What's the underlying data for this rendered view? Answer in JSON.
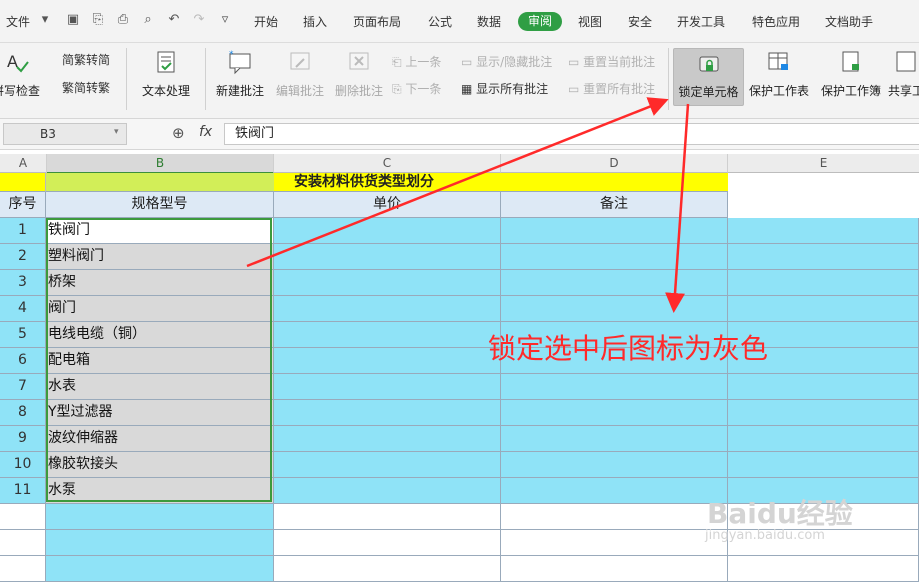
{
  "menubar": {
    "file": "文件",
    "tabs": [
      "开始",
      "插入",
      "页面布局",
      "公式",
      "数据",
      "审阅",
      "视图",
      "安全",
      "开发工具",
      "特色应用",
      "文档助手"
    ],
    "active_tab": "审阅"
  },
  "ribbon": {
    "spell_check": "拼写检查",
    "trad_to_simp": "繁转简",
    "simp_to_trad": "简转繁",
    "text_process": "文本处理",
    "new_comment": "新建批注",
    "edit_comment": "编辑批注",
    "delete_comment": "删除批注",
    "prev": "上一条",
    "next": "下一条",
    "show_hide_comment": "显示/隐藏批注",
    "show_all_comments": "显示所有批注",
    "reset_current": "重置当前批注",
    "reset_all": "重置所有批注",
    "lock_cell": "锁定单元格",
    "protect_sheet": "保护工作表",
    "protect_book": "保护工作簿",
    "share": "共享工"
  },
  "formula_bar": {
    "cell_ref": "B3",
    "fx": "fx",
    "value": "铁阀门"
  },
  "sheet": {
    "columns": [
      "A",
      "B",
      "C",
      "D",
      "E"
    ],
    "title": "安装材料供货类型划分",
    "headers": [
      "序号",
      "规格型号",
      "单价",
      "备注"
    ],
    "rows": [
      {
        "no": "1",
        "name": "铁阀门"
      },
      {
        "no": "2",
        "name": "塑料阀门"
      },
      {
        "no": "3",
        "name": "桥架"
      },
      {
        "no": "4",
        "name": "阀门"
      },
      {
        "no": "5",
        "name": "电线电缆（铜）"
      },
      {
        "no": "6",
        "name": "配电箱"
      },
      {
        "no": "7",
        "name": "水表"
      },
      {
        "no": "8",
        "name": "Y型过滤器"
      },
      {
        "no": "9",
        "name": "波纹伸缩器"
      },
      {
        "no": "10",
        "name": "橡胶软接头"
      },
      {
        "no": "11",
        "name": "水泵"
      }
    ]
  },
  "annotation": "锁定选中后图标为灰色",
  "watermark": {
    "logo": "Baidu经验",
    "url": "jingyan.baidu.com"
  },
  "colors": {
    "accent": "#2f9e44",
    "cell_blue": "#8fe3f7",
    "title_yellow": "#ffff00",
    "arrow_red": "#ff2a2a"
  }
}
